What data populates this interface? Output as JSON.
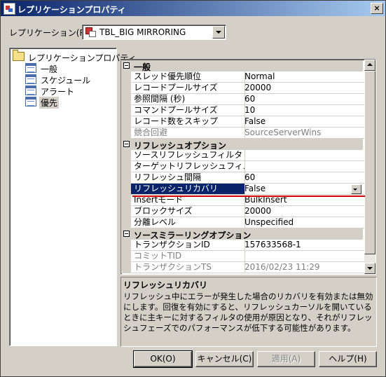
{
  "window": {
    "title": "レプリケーションプロパティ",
    "close_label": "×"
  },
  "publication": {
    "label": "レプリケーション(R)",
    "selected": "TBL_BIG MIRRORING"
  },
  "tree": {
    "root": "レプリケーションプロパティ",
    "items": [
      "一般",
      "スケジュール",
      "アラート",
      "優先"
    ]
  },
  "grid": {
    "cat_general": "一般",
    "cat_refresh": "リフレッシュオプション",
    "cat_source": "ソースミラーリングオプション",
    "rows": [
      {
        "name": "スレッド優先順位",
        "value": "Normal"
      },
      {
        "name": "レコードプールサイズ",
        "value": "20000"
      },
      {
        "name": "参照間隔 (秒)",
        "value": "60"
      },
      {
        "name": "コマンドプールサイズ",
        "value": "10"
      },
      {
        "name": "レコード数をスキップ",
        "value": "False"
      },
      {
        "name": "競合回避",
        "value": "SourceServerWins"
      },
      {
        "name": "ソースリフレッシュフィルタ",
        "value": ""
      },
      {
        "name": "ターゲットリフレッシュフィルタ",
        "value": ""
      },
      {
        "name": "リフレッシュ間隔",
        "value": "60"
      },
      {
        "name": "リフレッシュリカバリ",
        "value": "False"
      },
      {
        "name": "Insertモード",
        "value": "BulkInsert"
      },
      {
        "name": "ブロックサイズ",
        "value": "20000"
      },
      {
        "name": "分離レベル",
        "value": "Unspecified"
      },
      {
        "name": "トランザクションID",
        "value": "157633568-1"
      },
      {
        "name": "コミットTID",
        "value": ""
      },
      {
        "name": "トランザクションTS",
        "value": "2016/02/23 11:29"
      }
    ]
  },
  "description": {
    "title": "リフレッシュリカバリ",
    "body": "リフレッシュ中にエラーが発生した場合のリカバリを有効または無効にします。回復を有効にすると、リフレッシュカーソルを開いているときに主キーに対するフィルタの使用が原因となり、それがリフレッシュフェーズでのパフォーマンスが低下する可能性があります。"
  },
  "buttons": {
    "ok": "OK(O)",
    "cancel": "キャンセル(C)",
    "apply": "適用(A)",
    "help": "ヘルプ(H)"
  }
}
